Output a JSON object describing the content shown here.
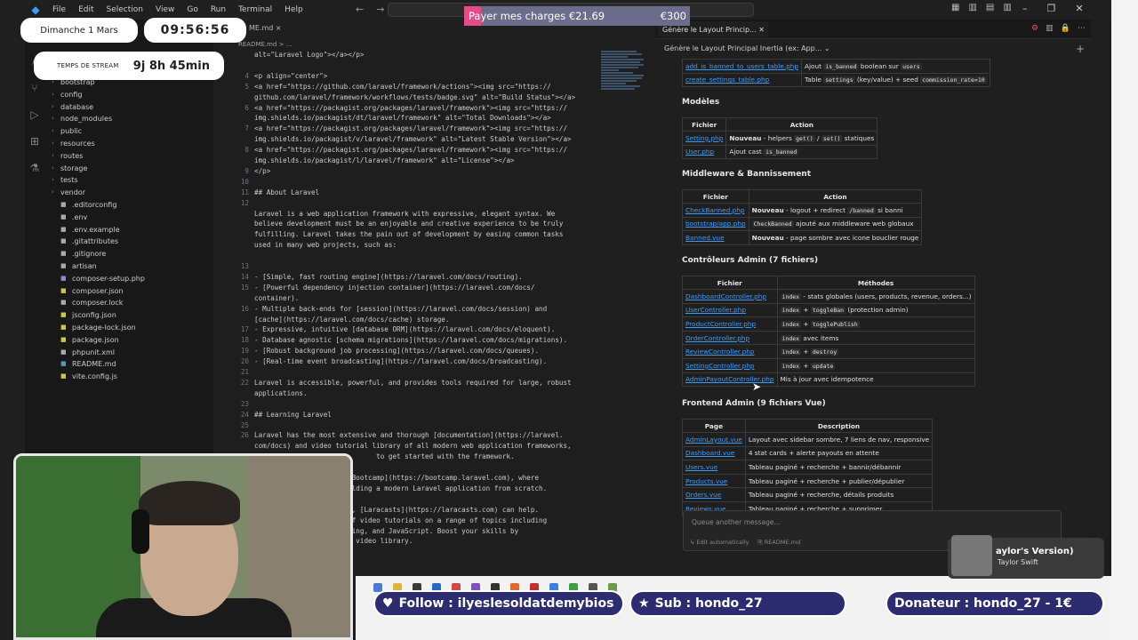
{
  "menu": {
    "items": [
      "File",
      "Edit",
      "Selection",
      "View",
      "Go",
      "Run",
      "Terminal",
      "Help"
    ]
  },
  "overlay": {
    "date": "Dimanche 1 Mars",
    "clock": "09:56:56",
    "stream_label": "TEMPS DE STREAM",
    "stream_time": "9j 8h 45min",
    "charge_label": "Payer mes charges €21.69",
    "charge_goal": "€300",
    "charge_progress": 0.072,
    "follow": "Follow : ilyeslesoldatdemybios",
    "sub": "Sub : hondo_27",
    "donateur": "Donateur : hondo_27 - 1€",
    "music_title": "aylor's Version)",
    "music_artist": "Taylor Swift"
  },
  "explorer": {
    "items": [
      {
        "name": "bootstrap",
        "type": "folder"
      },
      {
        "name": "config",
        "type": "folder"
      },
      {
        "name": "database",
        "type": "folder"
      },
      {
        "name": "node_modules",
        "type": "folder"
      },
      {
        "name": "public",
        "type": "folder"
      },
      {
        "name": "resources",
        "type": "folder"
      },
      {
        "name": "routes",
        "type": "folder"
      },
      {
        "name": "storage",
        "type": "folder"
      },
      {
        "name": "tests",
        "type": "folder"
      },
      {
        "name": "vendor",
        "type": "folder"
      },
      {
        "name": ".editorconfig",
        "type": "file"
      },
      {
        "name": ".env",
        "type": "file"
      },
      {
        "name": ".env.example",
        "type": "file"
      },
      {
        "name": ".gitattributes",
        "type": "file"
      },
      {
        "name": ".gitignore",
        "type": "file"
      },
      {
        "name": "artisan",
        "type": "file"
      },
      {
        "name": "composer-setup.php",
        "type": "file"
      },
      {
        "name": "composer.json",
        "type": "file"
      },
      {
        "name": "composer.lock",
        "type": "file"
      },
      {
        "name": "jsconfig.json",
        "type": "file"
      },
      {
        "name": "package-lock.json",
        "type": "file"
      },
      {
        "name": "package.json",
        "type": "file"
      },
      {
        "name": "phpunit.xml",
        "type": "file"
      },
      {
        "name": "README.md",
        "type": "file"
      },
      {
        "name": "vite.config.js",
        "type": "file"
      }
    ]
  },
  "editor": {
    "tab": "ME.md ×",
    "breadcrumb": "README.md > ...",
    "lines": [
      {
        "n": "",
        "t": "alt=\"Laravel Logo\"></a></p>"
      },
      {
        "n": "",
        "t": ""
      },
      {
        "n": "4",
        "t": "<p align=\"center\">"
      },
      {
        "n": "5",
        "t": "<a href=\"https://github.com/laravel/framework/actions\"><img src=\"https://"
      },
      {
        "n": "",
        "t": "github.com/laravel/framework/workflows/tests/badge.svg\" alt=\"Build Status\"></a>"
      },
      {
        "n": "6",
        "t": "<a href=\"https://packagist.org/packages/laravel/framework\"><img src=\"https://"
      },
      {
        "n": "",
        "t": "img.shields.io/packagist/dt/laravel/framework\" alt=\"Total Downloads\"></a>"
      },
      {
        "n": "7",
        "t": "<a href=\"https://packagist.org/packages/laravel/framework\"><img src=\"https://"
      },
      {
        "n": "",
        "t": "img.shields.io/packagist/v/laravel/framework\" alt=\"Latest Stable Version\"></a>"
      },
      {
        "n": "8",
        "t": "<a href=\"https://packagist.org/packages/laravel/framework\"><img src=\"https://"
      },
      {
        "n": "",
        "t": "img.shields.io/packagist/l/laravel/framework\" alt=\"License\"></a>"
      },
      {
        "n": "9",
        "t": "</p>"
      },
      {
        "n": "10",
        "t": ""
      },
      {
        "n": "11",
        "t": "## About Laravel"
      },
      {
        "n": "12",
        "t": ""
      },
      {
        "n": "",
        "t": "Laravel is a web application framework with expressive, elegant syntax. We"
      },
      {
        "n": "",
        "t": "believe development must be an enjoyable and creative experience to be truly"
      },
      {
        "n": "",
        "t": "fulfilling. Laravel takes the pain out of development by easing common tasks"
      },
      {
        "n": "",
        "t": "used in many web projects, such as:"
      },
      {
        "n": "",
        "t": ""
      },
      {
        "n": "13",
        "t": ""
      },
      {
        "n": "14",
        "t": "- [Simple, fast routing engine](https://laravel.com/docs/routing)."
      },
      {
        "n": "15",
        "t": "- [Powerful dependency injection container](https://laravel.com/docs/"
      },
      {
        "n": "",
        "t": "container)."
      },
      {
        "n": "16",
        "t": "- Multiple back-ends for [session](https://laravel.com/docs/session) and"
      },
      {
        "n": "",
        "t": "[cache](https://laravel.com/docs/cache) storage."
      },
      {
        "n": "17",
        "t": "- Expressive, intuitive [database ORM](https://laravel.com/docs/eloquent)."
      },
      {
        "n": "18",
        "t": "- Database agnostic [schema migrations](https://laravel.com/docs/migrations)."
      },
      {
        "n": "19",
        "t": "- [Robust background job processing](https://laravel.com/docs/queues)."
      },
      {
        "n": "20",
        "t": "- [Real-time event broadcasting](https://laravel.com/docs/broadcasting)."
      },
      {
        "n": "21",
        "t": ""
      },
      {
        "n": "22",
        "t": "Laravel is accessible, powerful, and provides tools required for large, robust"
      },
      {
        "n": "",
        "t": "applications."
      },
      {
        "n": "23",
        "t": ""
      },
      {
        "n": "24",
        "t": "## Learning Laravel"
      },
      {
        "n": "25",
        "t": ""
      },
      {
        "n": "26",
        "t": "Laravel has the most extensive and thorough [documentation](https://laravel."
      },
      {
        "n": "",
        "t": "com/docs) and video tutorial library of all modern web application frameworks,"
      },
      {
        "n": "",
        "t": "                              to get started with the framework."
      },
      {
        "n": "",
        "t": ""
      },
      {
        "n": "",
        "t": "                  ravel Bootcamp](https://bootcamp.laravel.com), where"
      },
      {
        "n": "",
        "t": "                  gh building a modern Laravel application from scratch."
      },
      {
        "n": "",
        "t": ""
      },
      {
        "n": "",
        "t": "                  eading, [Laracasts](https://laracasts.com) can help."
      },
      {
        "n": "",
        "t": "                  ands of video tutorials on a range of topics including"
      },
      {
        "n": "",
        "t": "                  t testing, and JavaScript. Boost your skills by"
      },
      {
        "n": "",
        "t": "                  ensive video library."
      }
    ]
  },
  "chat": {
    "tab_label": "Génère le Layout Princip...",
    "title": "Génère le Layout Principal Inertia (ex: App...",
    "placeholder": "Queue another message...",
    "foot_edit": "Edit automatically",
    "foot_file": "README.md",
    "top_rows": [
      {
        "file": "add_is_banned_to_users_table.php",
        "desc_pre": "Ajout",
        "code1": "is_banned",
        "desc_mid": "boolean sur",
        "code2": "users"
      },
      {
        "file": "create_settings_table.php",
        "desc_pre": "Table",
        "code1": "settings",
        "desc_mid": "(key/value) + seed",
        "code2": "commission_rate=10"
      }
    ],
    "modeles": {
      "title": "Modèles",
      "headers": [
        "Fichier",
        "Action"
      ],
      "rows": [
        {
          "file": "Setting.php",
          "bold": "Nouveau",
          "rest": " - helpers ",
          "code1": "get()",
          "mid": " / ",
          "code2": "set()",
          "end": " statiques"
        },
        {
          "file": "User.php",
          "bold": "",
          "rest": "Ajout cast ",
          "code1": "is_banned",
          "mid": "",
          "code2": "",
          "end": ""
        }
      ]
    },
    "middleware": {
      "title": "Middleware & Bannissement",
      "headers": [
        "Fichier",
        "Action"
      ],
      "rows": [
        {
          "file": "CheckBanned.php",
          "bold": "Nouveau",
          "rest": " - logout + redirect ",
          "code1": "/banned",
          "end": " si banni"
        },
        {
          "file": "bootstrap/app.php",
          "bold": "",
          "rest": "",
          "code1": "CheckBanned",
          "end": " ajouté aux middleware web globaux"
        },
        {
          "file": "Banned.vue",
          "bold": "Nouveau",
          "rest": " - page sombre avec icone bouclier rouge",
          "code1": "",
          "end": ""
        }
      ]
    },
    "controleurs": {
      "title": "Contrôleurs Admin (7 fichiers)",
      "headers": [
        "Fichier",
        "Méthodes"
      ],
      "rows": [
        {
          "file": "DashboardController.php",
          "code1": "index",
          "code2": "",
          "end": " - stats globales (users, products, revenue, orders...)"
        },
        {
          "file": "UserController.php",
          "code1": "index",
          "code2": "toggleBan",
          "end": " (protection admin)"
        },
        {
          "file": "ProductController.php",
          "code1": "index",
          "code2": "togglePublish",
          "end": ""
        },
        {
          "file": "OrderController.php",
          "code1": "index",
          "code2": "",
          "end": " avec items"
        },
        {
          "file": "ReviewController.php",
          "code1": "index",
          "code2": "destroy",
          "end": ""
        },
        {
          "file": "SettingController.php",
          "code1": "index",
          "code2": "update",
          "end": ""
        },
        {
          "file": "AdminPayoutController.php",
          "code1": "",
          "code2": "",
          "end": "Mis à jour avec idempotence"
        }
      ]
    },
    "frontend": {
      "title": "Frontend Admin (9 fichiers Vue)",
      "headers": [
        "Page",
        "Description"
      ],
      "rows": [
        {
          "file": "AdminLayout.vue",
          "desc": "Layout avec sidebar sombre, 7 liens de nav, responsive"
        },
        {
          "file": "Dashboard.vue",
          "desc": "4 stat cards + alerte payouts en attente"
        },
        {
          "file": "Users.vue",
          "desc": "Tableau paginé + recherche + bannir/débannir"
        },
        {
          "file": "Products.vue",
          "desc": "Tableau paginé + recherche + publier/dépublier"
        },
        {
          "file": "Orders.vue",
          "desc": "Tableau paginé + recherche, détails produits"
        },
        {
          "file": "Reviews.vue",
          "desc": "Tableau paginé + recherche + supprimer"
        }
      ]
    }
  },
  "colors": {
    "accent": "#3b9cff",
    "charge_fill": "#e84a86",
    "banner": "#2c2c6e"
  }
}
